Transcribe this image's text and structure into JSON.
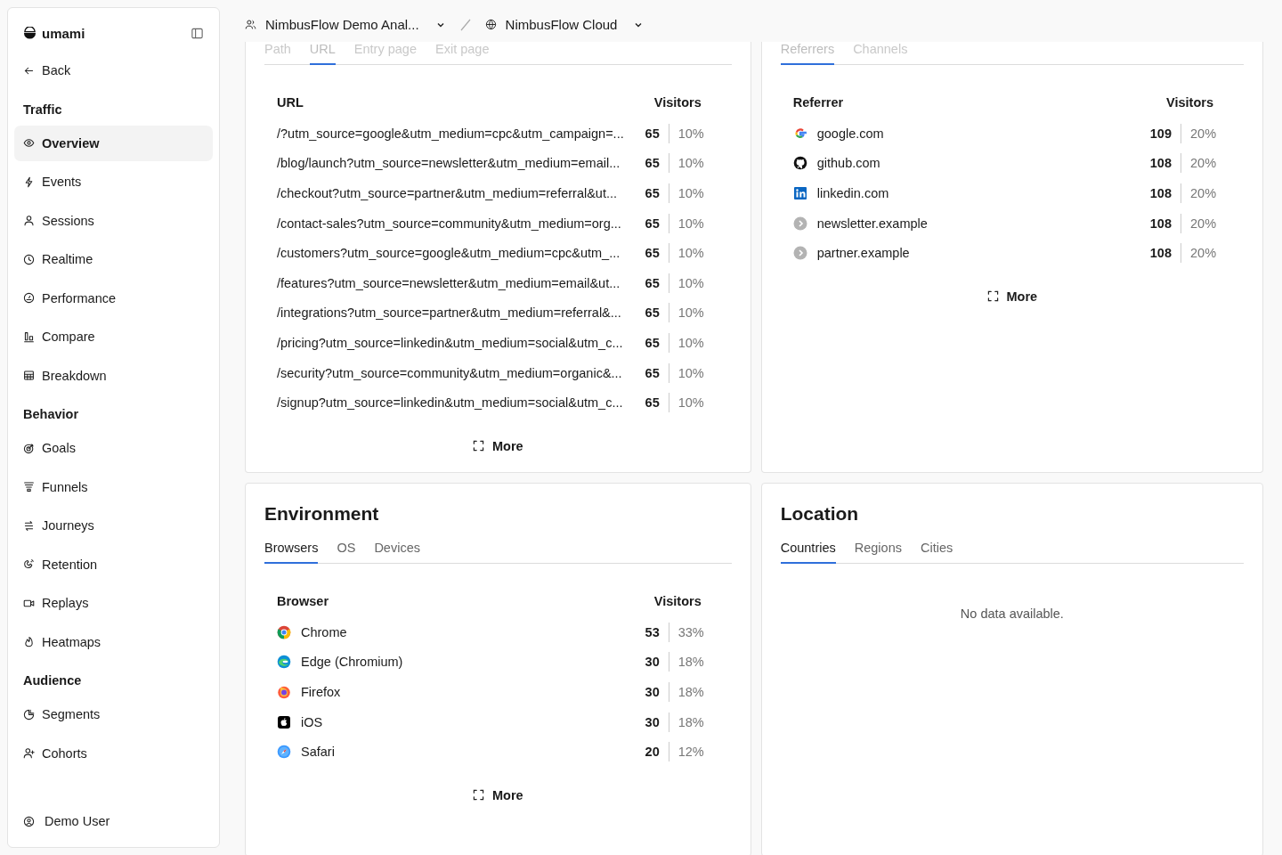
{
  "sidebar": {
    "brand": "umami",
    "back": "Back",
    "sections": [
      {
        "title": "Traffic",
        "items": [
          {
            "label": "Overview",
            "selected": true
          },
          {
            "label": "Events",
            "selected": false
          },
          {
            "label": "Sessions",
            "selected": false
          },
          {
            "label": "Realtime",
            "selected": false
          },
          {
            "label": "Performance",
            "selected": false
          },
          {
            "label": "Compare",
            "selected": false
          },
          {
            "label": "Breakdown",
            "selected": false
          }
        ]
      },
      {
        "title": "Behavior",
        "items": [
          {
            "label": "Goals",
            "selected": false
          },
          {
            "label": "Funnels",
            "selected": false
          },
          {
            "label": "Journeys",
            "selected": false
          },
          {
            "label": "Retention",
            "selected": false
          },
          {
            "label": "Replays",
            "selected": false
          },
          {
            "label": "Heatmaps",
            "selected": false
          }
        ]
      },
      {
        "title": "Audience",
        "items": [
          {
            "label": "Segments",
            "selected": false
          },
          {
            "label": "Cohorts",
            "selected": false
          }
        ]
      }
    ],
    "user": "Demo User"
  },
  "header": {
    "team": "NimbusFlow Demo Anal...",
    "website": "NimbusFlow Cloud"
  },
  "panels": [
    {
      "tabs": [
        {
          "label": "Path",
          "selected": false
        },
        {
          "label": "URL",
          "selected": true
        },
        {
          "label": "Entry page",
          "selected": false
        },
        {
          "label": "Exit page",
          "selected": false
        }
      ],
      "columns": [
        "URL",
        "Visitors"
      ],
      "rows": [
        {
          "label": "/?utm_source=google&utm_medium=cpc&utm_campaign=...",
          "value": "65",
          "percent": "10%"
        },
        {
          "label": "/blog/launch?utm_source=newsletter&utm_medium=email...",
          "value": "65",
          "percent": "10%"
        },
        {
          "label": "/checkout?utm_source=partner&utm_medium=referral&ut...",
          "value": "65",
          "percent": "10%"
        },
        {
          "label": "/contact-sales?utm_source=community&utm_medium=org...",
          "value": "65",
          "percent": "10%"
        },
        {
          "label": "/customers?utm_source=google&utm_medium=cpc&utm_...",
          "value": "65",
          "percent": "10%"
        },
        {
          "label": "/features?utm_source=newsletter&utm_medium=email&ut...",
          "value": "65",
          "percent": "10%"
        },
        {
          "label": "/integrations?utm_source=partner&utm_medium=referral&...",
          "value": "65",
          "percent": "10%"
        },
        {
          "label": "/pricing?utm_source=linkedin&utm_medium=social&utm_c...",
          "value": "65",
          "percent": "10%"
        },
        {
          "label": "/security?utm_source=community&utm_medium=organic&...",
          "value": "65",
          "percent": "10%"
        },
        {
          "label": "/signup?utm_source=linkedin&utm_medium=social&utm_c...",
          "value": "65",
          "percent": "10%"
        }
      ],
      "more": "More"
    },
    {
      "tabs": [
        {
          "label": "Referrers",
          "selected": true
        },
        {
          "label": "Channels",
          "selected": false
        }
      ],
      "columns": [
        "Referrer",
        "Visitors"
      ],
      "rows": [
        {
          "label": "google.com",
          "value": "109",
          "percent": "20%"
        },
        {
          "label": "github.com",
          "value": "108",
          "percent": "20%"
        },
        {
          "label": "linkedin.com",
          "value": "108",
          "percent": "20%"
        },
        {
          "label": "newsletter.example",
          "value": "108",
          "percent": "20%"
        },
        {
          "label": "partner.example",
          "value": "108",
          "percent": "20%"
        }
      ],
      "more": "More"
    },
    {
      "title": "Environment",
      "tabs": [
        {
          "label": "Browsers",
          "selected": true
        },
        {
          "label": "OS",
          "selected": false
        },
        {
          "label": "Devices",
          "selected": false
        }
      ],
      "columns": [
        "Browser",
        "Visitors"
      ],
      "rows": [
        {
          "label": "Chrome",
          "value": "53",
          "percent": "33%"
        },
        {
          "label": "Edge (Chromium)",
          "value": "30",
          "percent": "18%"
        },
        {
          "label": "Firefox",
          "value": "30",
          "percent": "18%"
        },
        {
          "label": "iOS",
          "value": "30",
          "percent": "18%"
        },
        {
          "label": "Safari",
          "value": "20",
          "percent": "12%"
        }
      ],
      "more": "More"
    },
    {
      "title": "Location",
      "tabs": [
        {
          "label": "Countries",
          "selected": true
        },
        {
          "label": "Regions",
          "selected": false
        },
        {
          "label": "Cities",
          "selected": false
        }
      ],
      "empty": "No data available."
    }
  ]
}
